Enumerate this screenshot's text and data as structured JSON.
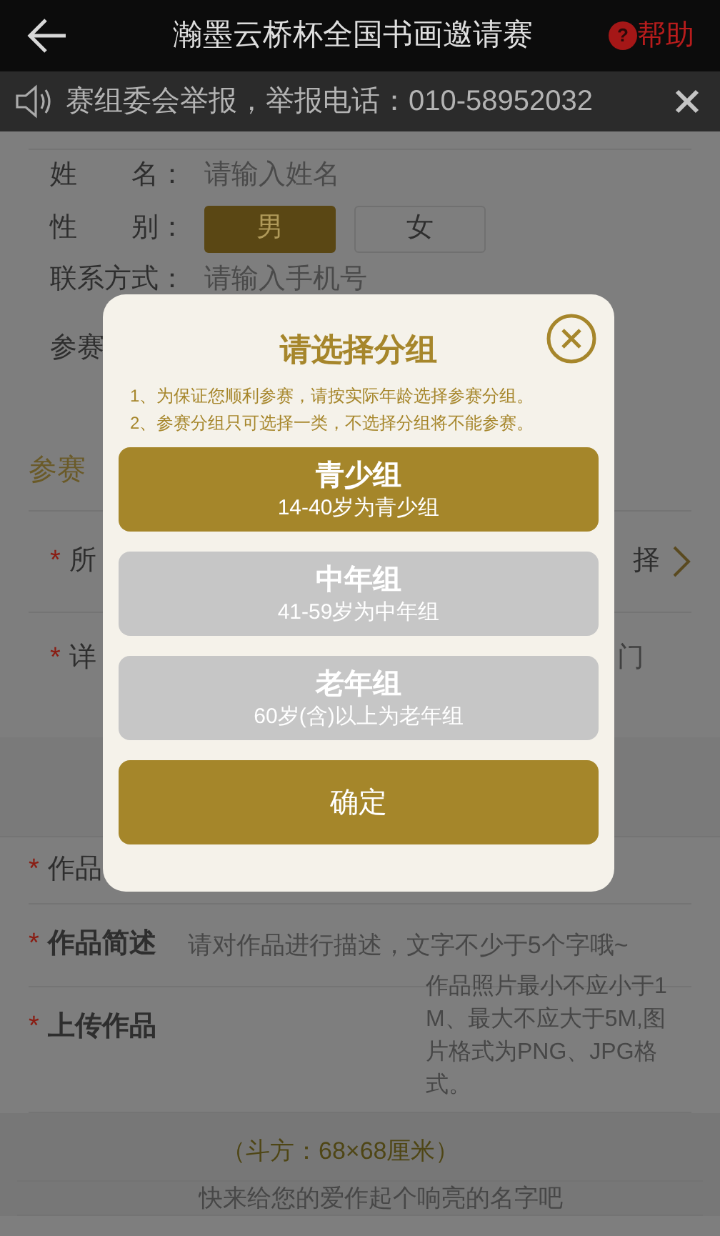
{
  "header": {
    "title": "瀚墨云桥杯全国书画邀请赛",
    "help_icon": "?",
    "help_label": "帮助"
  },
  "notice": {
    "text": "赛组委会举报，举报电话：010-58952032"
  },
  "basic": {
    "name_label": "姓　　名：",
    "name_placeholder": "请输入姓名",
    "gender_label": "性　　别：",
    "genders": [
      {
        "label": "男",
        "selected": true
      },
      {
        "label": "女",
        "selected": false
      }
    ],
    "phone_label": "联系方式：",
    "phone_placeholder": "请输入手机号",
    "group_label": "参赛"
  },
  "entry": {
    "heading": "参赛",
    "rows": [
      {
        "required_mark": "*",
        "label": "所",
        "value": "择"
      },
      {
        "required_mark": "*",
        "label": "详",
        "value": "门"
      }
    ]
  },
  "work": {
    "rows": [
      {
        "required_mark": "*",
        "label": "作品"
      },
      {
        "required_mark": "*",
        "label": "作品简述",
        "placeholder": "请对作品进行描述，文字不少于5个字哦~"
      },
      {
        "required_mark": "*",
        "label": "上传作品",
        "hint": "作品照片最小不应小于1M、最大不应大于5M,图片格式为PNG、JPG格式。"
      }
    ]
  },
  "size_note": "（斗方：68×68厘米）",
  "title_placeholder": "快来给您的爱作起个响亮的名字吧",
  "modal": {
    "title": "请选择分组",
    "notes": [
      "1、为保证您顺利参赛，请按实际年龄选择参赛分组。",
      "2、参赛分组只可选择一类，不选择分组将不能参赛。"
    ],
    "groups": [
      {
        "name": "青少组",
        "range": "14-40岁为青少组",
        "selected": true
      },
      {
        "name": "中年组",
        "range": "41-59岁为中年组",
        "selected": false
      },
      {
        "name": "老年组",
        "range": "60岁(含)以上为老年组",
        "selected": false
      }
    ],
    "confirm": "确定"
  }
}
